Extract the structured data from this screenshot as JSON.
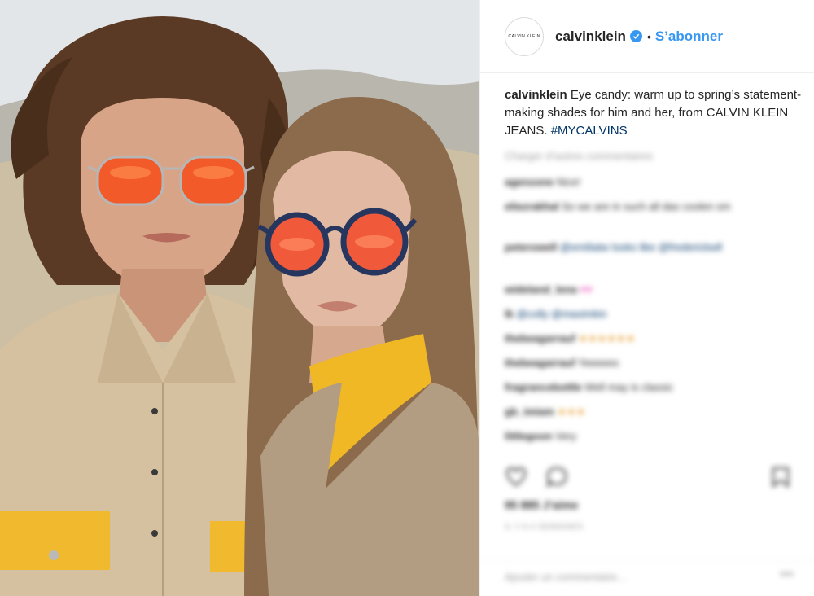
{
  "header": {
    "avatar_text": "CALVIN KLEIN",
    "username": "calvinklein",
    "separator": "•",
    "follow_label": "S’abonner"
  },
  "caption": {
    "username": "calvinklein",
    "text": "Eye candy: warm up to spring’s statement-making shades for him and her, from CALVIN KLEIN JEANS.",
    "hashtag": "#MYCALVINS"
  },
  "comments": {
    "load_more": "Charger d’autres commentaires",
    "items": [
      {
        "user": "agenzone",
        "text": "Nice!",
        "mention": "",
        "emoji": ""
      },
      {
        "user": "eliezrakhal",
        "text": "So we are in such all das coolen sm",
        "mention": "",
        "emoji": ""
      },
      {
        "user": "peterowell",
        "text": "",
        "mention": "@emiliatw looks like @frederickwll",
        "emoji": ""
      },
      {
        "user": "wideland_lena",
        "text": "",
        "mention": "",
        "emoji": "♥♥"
      },
      {
        "user": "lk",
        "text": "",
        "mention": "@colly @maximkin",
        "emoji": ""
      },
      {
        "user": "thebeagarrauf",
        "text": "",
        "mention": "",
        "emoji": "★★★★★★"
      },
      {
        "user": "thebeagarrauf",
        "text": "Yeeeees",
        "mention": "",
        "emoji": ""
      },
      {
        "user": "fragrancebottle",
        "text": "Well may is classic",
        "mention": "",
        "emoji": ""
      },
      {
        "user": "gb_imiam",
        "text": "",
        "mention": "",
        "emoji": "★★★"
      },
      {
        "user": "littlegoon",
        "text": "Very",
        "mention": "",
        "emoji": ""
      }
    ]
  },
  "actions": {
    "likes": "95 885 J’aime",
    "date": "IL Y A 4 SEMAINES"
  },
  "add_comment": {
    "placeholder": "Ajouter un commentaire…",
    "more": "•••"
  },
  "colors": {
    "accent": "#3897f0",
    "hashtag": "#003569",
    "text": "#262626",
    "muted": "#999999"
  }
}
